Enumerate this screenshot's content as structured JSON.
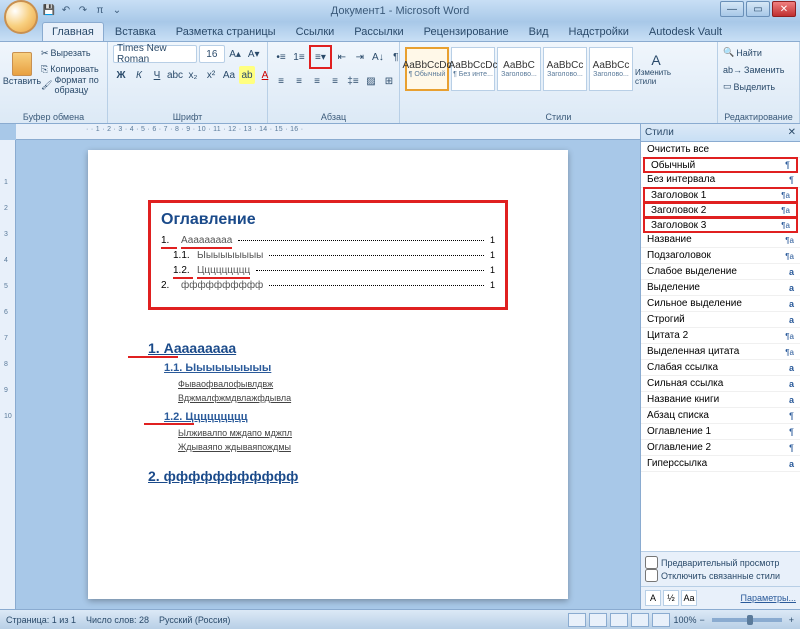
{
  "window": {
    "title": "Документ1 - Microsoft Word"
  },
  "tabs": [
    "Главная",
    "Вставка",
    "Разметка страницы",
    "Ссылки",
    "Рассылки",
    "Рецензирование",
    "Вид",
    "Надстройки",
    "Autodesk Vault"
  ],
  "active_tab": 0,
  "ribbon": {
    "clipboard": {
      "label": "Буфер обмена",
      "paste": "Вставить",
      "cut": "Вырезать",
      "copy": "Копировать",
      "fmt": "Формат по образцу"
    },
    "font": {
      "label": "Шрифт",
      "name": "Times New Roman",
      "size": "16"
    },
    "paragraph": {
      "label": "Абзац"
    },
    "styles": {
      "label": "Стили",
      "tiles": [
        {
          "sample": "AaBbCcDc",
          "name": "¶ Обычный",
          "sel": true
        },
        {
          "sample": "AaBbCcDc",
          "name": "¶ Без инте..."
        },
        {
          "sample": "AaBbC",
          "name": "Заголово..."
        },
        {
          "sample": "AaBbCc",
          "name": "Заголово..."
        },
        {
          "sample": "AaBbCc",
          "name": "Заголово..."
        }
      ],
      "change": "Изменить стили"
    },
    "editing": {
      "label": "Редактирование",
      "find": "Найти",
      "replace": "Заменить",
      "select": "Выделить"
    }
  },
  "doc": {
    "toc_title": "Оглавление",
    "toc": [
      {
        "lvl": 1,
        "num": "1.",
        "txt": "Ааааааааа",
        "pg": "1",
        "u": true
      },
      {
        "lvl": 2,
        "num": "1.1.",
        "txt": "Ыыыыыыыыы",
        "pg": "1"
      },
      {
        "lvl": 2,
        "num": "1.2.",
        "txt": "Ццццццццц",
        "pg": "1",
        "u": true
      },
      {
        "lvl": 1,
        "num": "2.",
        "txt": "фффффффффф",
        "pg": "1"
      }
    ],
    "headings": [
      {
        "type": "h1",
        "num": "1.",
        "txt": "Ааааааааа",
        "red": true
      },
      {
        "type": "h2",
        "num": "1.1.",
        "txt": "Ыыыыыыыыы"
      },
      {
        "type": "body",
        "lines": [
          "Фываофвалофывлдвж",
          "Вджмалфжмдвлажфдывла"
        ]
      },
      {
        "type": "h2",
        "num": "1.2.",
        "txt": "Ццццццццц",
        "red": true
      },
      {
        "type": "body",
        "lines": [
          "Ылживалпо мждапо мджпл",
          "Ждываяпо ждываяпождмы"
        ]
      },
      {
        "type": "h1",
        "num": "2.",
        "txt": "ффффффффффф"
      }
    ]
  },
  "styles_pane": {
    "title": "Стили",
    "items": [
      {
        "label": "Очистить все",
        "mark": ""
      },
      {
        "label": "Обычный",
        "mark": "p",
        "hl": true
      },
      {
        "label": "Без интервала",
        "mark": "p"
      },
      {
        "label": "Заголовок 1",
        "mark": "pa",
        "hl": true
      },
      {
        "label": "Заголовок 2",
        "mark": "pa",
        "hl": true
      },
      {
        "label": "Заголовок 3",
        "mark": "pa",
        "hl": true
      },
      {
        "label": "Название",
        "mark": "pa"
      },
      {
        "label": "Подзаголовок",
        "mark": "pa"
      },
      {
        "label": "Слабое выделение",
        "mark": "a"
      },
      {
        "label": "Выделение",
        "mark": "a"
      },
      {
        "label": "Сильное выделение",
        "mark": "a"
      },
      {
        "label": "Строгий",
        "mark": "a"
      },
      {
        "label": "Цитата 2",
        "mark": "pa"
      },
      {
        "label": "Выделенная цитата",
        "mark": "pa"
      },
      {
        "label": "Слабая ссылка",
        "mark": "a"
      },
      {
        "label": "Сильная ссылка",
        "mark": "a"
      },
      {
        "label": "Название книги",
        "mark": "a"
      },
      {
        "label": "Абзац списка",
        "mark": "p"
      },
      {
        "label": "Оглавление 1",
        "mark": "p"
      },
      {
        "label": "Оглавление 2",
        "mark": "p"
      },
      {
        "label": "Гиперссылка",
        "mark": "a"
      }
    ],
    "preview": "Предварительный просмотр",
    "disable": "Отключить связанные стили",
    "options": "Параметры..."
  },
  "status": {
    "page": "Страница: 1 из 1",
    "words": "Число слов: 28",
    "lang": "Русский (Россия)",
    "zoom": "100%"
  }
}
